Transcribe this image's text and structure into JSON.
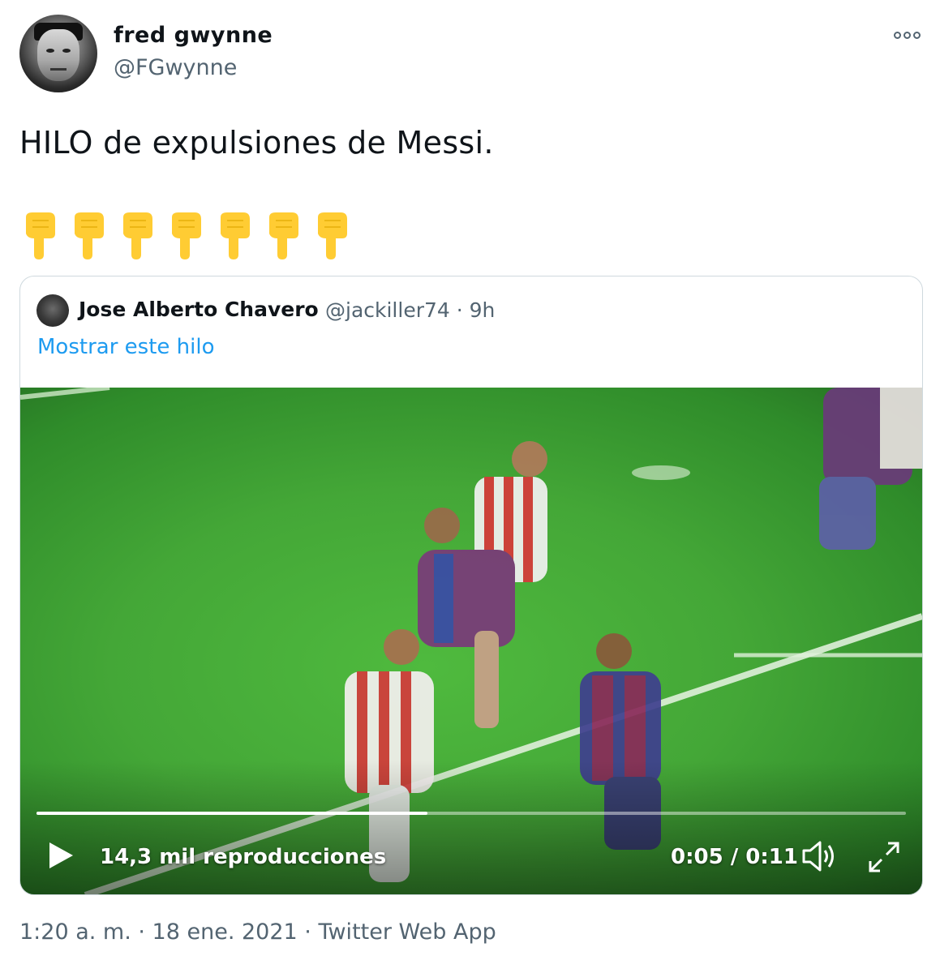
{
  "author": {
    "display_name": "fred gwynne",
    "handle": "@FGwynne"
  },
  "tweet": {
    "text": "HILO de expulsiones de Messi.",
    "emojis": [
      "👇",
      "👇",
      "👇",
      "👇",
      "👇",
      "👇",
      "👇"
    ]
  },
  "quoted": {
    "display_name": "Jose Alberto Chavero",
    "meta": "@jackiller74 · 9h",
    "show_thread": "Mostrar este hilo"
  },
  "video": {
    "views": "14,3 mil reproducciones",
    "time": "0:05 / 0:11",
    "progress": 0.45
  },
  "footer": {
    "timestamp": "1:20 a. m. · 18 ene. 2021 · Twitter Web App"
  },
  "icons": {
    "more": "more-options-icon",
    "play": "play-icon",
    "volume": "volume-icon",
    "fullscreen": "fullscreen-icon"
  },
  "colors": {
    "link": "#1d9bf0",
    "secondary_text": "#536471",
    "border": "#cfd9de",
    "emoji_yellow": "#ffcc33"
  }
}
